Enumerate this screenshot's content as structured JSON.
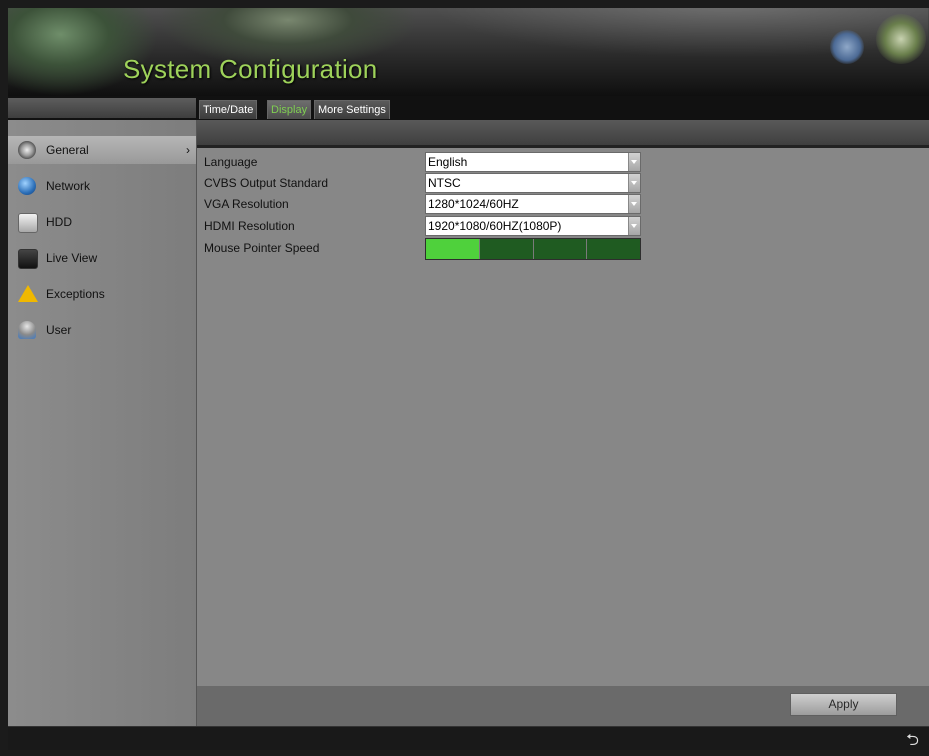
{
  "header": {
    "title": "System Configuration"
  },
  "tabs": [
    {
      "label": "Time/Date",
      "active": false
    },
    {
      "label": "Display",
      "active": true
    },
    {
      "label": "More Settings",
      "active": false
    }
  ],
  "sidebar": {
    "items": [
      {
        "label": "General",
        "icon": "gear-icon",
        "active": true,
        "arrow": "›"
      },
      {
        "label": "Network",
        "icon": "network-icon",
        "active": false
      },
      {
        "label": "HDD",
        "icon": "hdd-icon",
        "active": false
      },
      {
        "label": "Live View",
        "icon": "monitor-icon",
        "active": false
      },
      {
        "label": "Exceptions",
        "icon": "warning-icon",
        "active": false
      },
      {
        "label": "User",
        "icon": "user-icon",
        "active": false
      }
    ]
  },
  "settings": {
    "language": {
      "label": "Language",
      "value": "English"
    },
    "cvbs": {
      "label": "CVBS Output Standard",
      "value": "NTSC"
    },
    "vga": {
      "label": "VGA Resolution",
      "value": "1280*1024/60HZ"
    },
    "hdmi": {
      "label": "HDMI Resolution",
      "value": "1920*1080/60HZ(1080P)"
    },
    "mouse_speed": {
      "label": "Mouse Pointer Speed",
      "level": 1,
      "max": 4
    }
  },
  "footer": {
    "apply_label": "Apply"
  },
  "statusbar": {
    "back_glyph": "⮌"
  },
  "colors": {
    "title": "#9ed25a",
    "active_tab_text": "#7fce52",
    "speed_on": "#4fd13c",
    "speed_off": "#1f5b21"
  }
}
